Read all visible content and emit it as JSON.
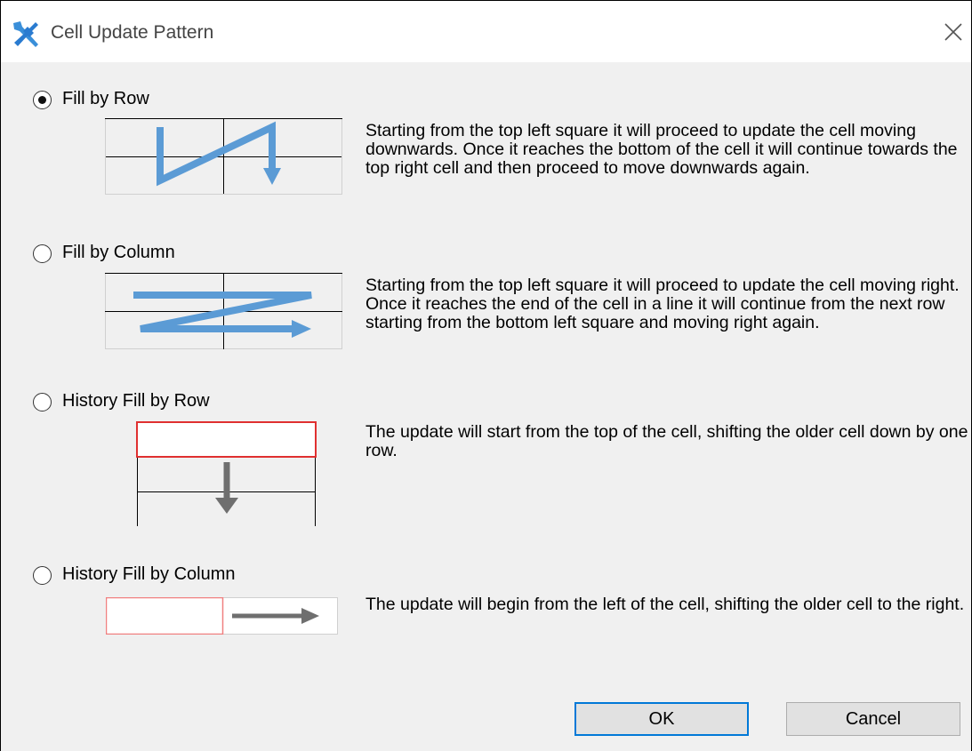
{
  "window": {
    "title": "Cell Update Pattern"
  },
  "options": [
    {
      "label": "Fill by Row",
      "selected": true,
      "description": "Starting from the top left square it will proceed to update the cell moving downwards. Once it reaches the bottom of the cell it will continue towards the top right cell and then proceed to move downwards again."
    },
    {
      "label": "Fill by Column",
      "selected": false,
      "description": "Starting from the top left square it will proceed to update the cell moving right. Once it reaches the end of the cell in a line it will continue from the next row starting from the bottom left square and moving right again."
    },
    {
      "label": "History Fill by Row",
      "selected": false,
      "description": "The update will start from the top of the cell, shifting the older cell down by one row."
    },
    {
      "label": "History Fill by Column",
      "selected": false,
      "description": "The update will begin from the left of the cell, shifting the older cell to the right."
    }
  ],
  "buttons": {
    "ok": "OK",
    "cancel": "Cancel"
  },
  "colors": {
    "arrow_blue": "#5b9bd5",
    "arrow_gray": "#6f6f6f",
    "highlight_red": "#e03030",
    "focus_border": "#0078d7"
  },
  "icons": {
    "app": "tools-icon",
    "close": "close-icon"
  }
}
